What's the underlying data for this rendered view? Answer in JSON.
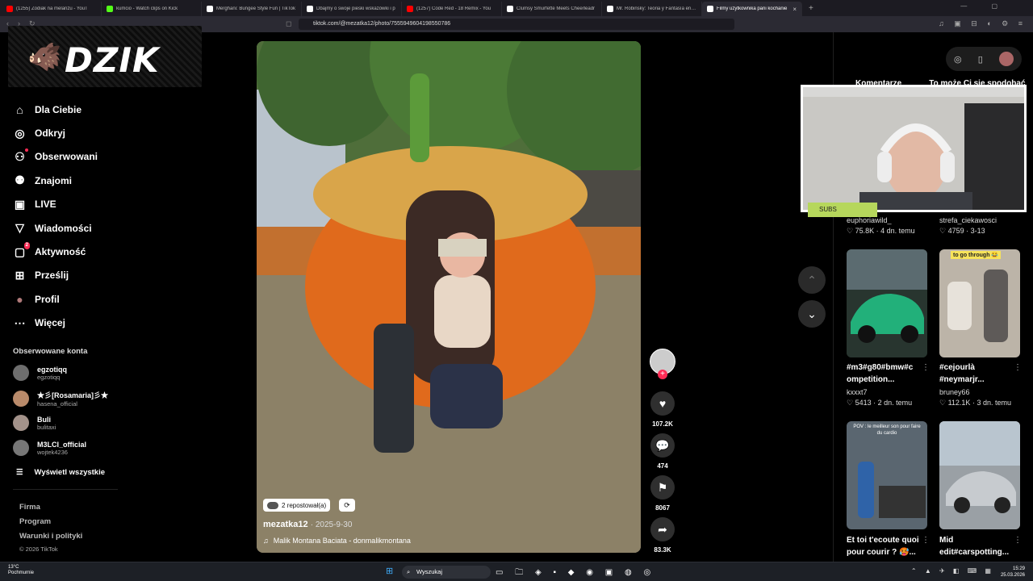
{
  "browser": {
    "tabs": [
      {
        "title": "(1255) Zodiak na melanżu - YouT",
        "color": "#ff0000"
      },
      {
        "title": "kumcio - Watch clips on Kick",
        "color": "#53fc18"
      },
      {
        "title": "Merghani: Bungee Style Fun | TikTok",
        "color": "#ffffff"
      },
      {
        "title": "Dbajmy o swoje pieski wskazówki i p",
        "color": "#ffffff"
      },
      {
        "title": "(1257) Code Red - 18 Remix - You",
        "color": "#ff0000"
      },
      {
        "title": "Clumsy Smurfette Meets Cheerleadr",
        "color": "#ffffff"
      },
      {
        "title": "Mr. Robinsky: Teoria y Fantasía en Cc",
        "color": "#ffffff"
      },
      {
        "title": "Filmy użytkownika pani kochanie",
        "color": "#ffffff",
        "active": true
      }
    ],
    "url": "tiktok.com/@mezatka12/photo/7555949604198550786"
  },
  "logo": {
    "text": "DZIK"
  },
  "nav": [
    {
      "label": "Dla Ciebie",
      "icon": "home-icon"
    },
    {
      "label": "Odkryj",
      "icon": "compass-icon"
    },
    {
      "label": "Obserwowani",
      "icon": "following-icon"
    },
    {
      "label": "Znajomi",
      "icon": "friends-icon"
    },
    {
      "label": "LIVE",
      "icon": "live-icon"
    },
    {
      "label": "Wiadomości",
      "icon": "messages-icon"
    },
    {
      "label": "Aktywność",
      "icon": "activity-icon",
      "badge": "2"
    },
    {
      "label": "Prześlij",
      "icon": "upload-icon"
    },
    {
      "label": "Profil",
      "icon": "profile-icon"
    },
    {
      "label": "Więcej",
      "icon": "more-icon"
    }
  ],
  "following": {
    "heading": "Obserwowane konta",
    "accounts": [
      {
        "name": "egzotiqq",
        "handle": "egzotiqq"
      },
      {
        "name": "★彡[Rosamaria]彡★",
        "handle": "hasena_official"
      },
      {
        "name": "Buli",
        "handle": "bulitaxi"
      },
      {
        "name": "M3LCI_official",
        "handle": "wojtek4236"
      }
    ],
    "show_all": "Wyświetl wszystkie"
  },
  "footer": {
    "links": [
      "Firma",
      "Program",
      "Warunki i polityki"
    ],
    "copyright": "© 2026 TikTok"
  },
  "post": {
    "repost_label": "2 repostował(a)",
    "author": "mezatka12",
    "date": "2025-9-30",
    "music": "Malik Montana Baciata - donmalikmontana",
    "likes": "107.2K",
    "comments": "474",
    "saves": "8067",
    "shares": "83.3K"
  },
  "right": {
    "tabs": [
      "Komentarze",
      "To może Ci się spodobać"
    ],
    "overlay_label": "SUBS",
    "videos": [
      {
        "user": "euphoriawild_",
        "likes": "75.8K",
        "time": "4 dn. temu"
      },
      {
        "user": "strefa_ciekawosci",
        "likes": "4759",
        "time": "3-13"
      },
      {
        "caption1": "#m3#g80#bmw#c",
        "caption2": "ompetition...",
        "user": "kxxxt7",
        "likes": "5413",
        "time": "2 dn. temu",
        "color": "#2aa877"
      },
      {
        "caption1": "#cejourlà",
        "caption2": "#neymarjr...",
        "user": "bruney66",
        "likes": "112.1K",
        "time": "3 dn. temu",
        "overlay": "to go through 😂",
        "color": "#bcb4a8"
      },
      {
        "caption1": "Et toi t'ecoute quoi",
        "caption2": "pour courir ? 🥵...",
        "overlay": "POV : le meilleur son pour faire du cardio",
        "color": "#5a6670"
      },
      {
        "caption1": "Mid",
        "caption2": "edit#carspotting...",
        "color": "#8a8f94"
      }
    ]
  },
  "taskbar": {
    "weather_temp": "13°C",
    "weather_desc": "Pochmurnie",
    "search": "Wyszukaj",
    "time": "15:29",
    "date": "25.03.2026"
  }
}
